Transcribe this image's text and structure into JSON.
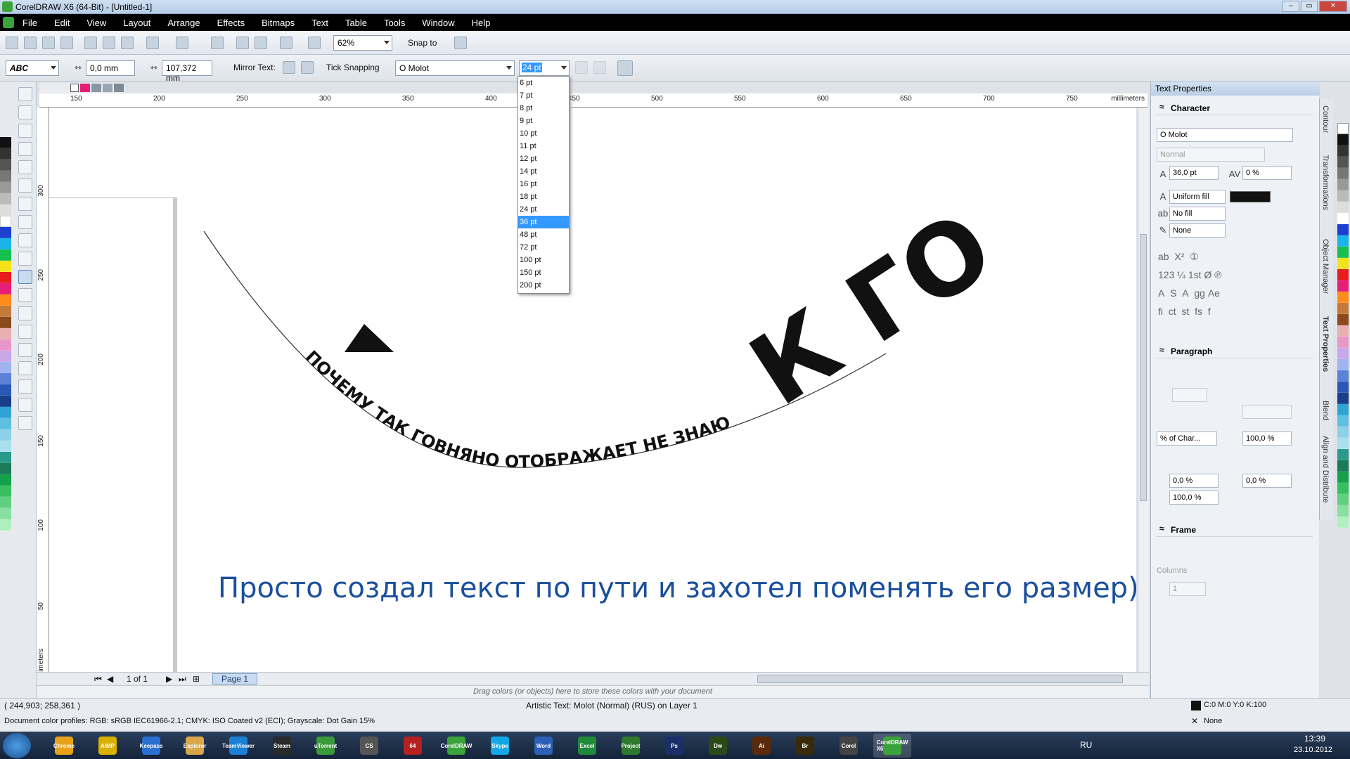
{
  "window": {
    "title": "CorelDRAW X6 (64-Bit) - [Untitled-1]"
  },
  "menu": [
    "File",
    "Edit",
    "View",
    "Layout",
    "Arrange",
    "Effects",
    "Bitmaps",
    "Text",
    "Table",
    "Tools",
    "Window",
    "Help"
  ],
  "toolbar": {
    "zoom": "62%",
    "snap_label": "Snap to"
  },
  "propbar": {
    "x_value": "0,0 mm",
    "y_value": "107,372 mm",
    "mirror_label": "Mirror Text:",
    "tick_snapping": "Tick Snapping",
    "font": "Molot",
    "size_value": "24 pt"
  },
  "size_options": [
    "6 pt",
    "7 pt",
    "8 pt",
    "9 pt",
    "10 pt",
    "11 pt",
    "12 pt",
    "14 pt",
    "16 pt",
    "18 pt",
    "24 pt",
    "36 pt",
    "48 pt",
    "72 pt",
    "100 pt",
    "150 pt",
    "200 pt"
  ],
  "size_selected_index": 11,
  "ruler": {
    "top_ticks": [
      "150",
      "200",
      "250",
      "300",
      "350",
      "400",
      "450",
      "500",
      "550",
      "600",
      "650",
      "700",
      "750"
    ],
    "units": "millimeters",
    "left_ticks": [
      "300",
      "250",
      "200",
      "150",
      "100",
      "50"
    ],
    "left_units": "millimeters"
  },
  "canvas": {
    "path_text": "ПОЧЕМУ ТАК ГОВНЯНО ОТОБРАЖАЕТ НЕ ЗНАЮ",
    "big_letters": "К ГО",
    "caption": "Просто создал текст по пути и захотел поменять его размер)"
  },
  "pager": {
    "count": "1 of 1",
    "page_tab": "Page 1"
  },
  "drag_hint": "Drag colors (or objects) here to store these colors with your document",
  "status": {
    "coords": "( 244,903; 258,361 )",
    "object_info": "Artistic Text: Molot (Normal) (RUS) on Layer 1",
    "fill_info": "C:0 M:0 Y:0 K:100",
    "outline_info": "None",
    "profiles": "Document color profiles: RGB: sRGB IEC61966-2.1; CMYK: ISO Coated v2 (ECI); Grayscale: Dot Gain 15%"
  },
  "docker": {
    "title": "Text Properties",
    "character_label": "Character",
    "font": "Molot",
    "style": "Normal",
    "size": "36,0 pt",
    "kerning": "0 %",
    "fill_type": "Uniform fill",
    "bg_fill": "No fill",
    "outline": "None",
    "paragraph_label": "Paragraph",
    "spacing_mode": "% of Char...",
    "line_spacing": "100,0 %",
    "char_spacing": "0,0 %",
    "word_spacing": "0,0 %",
    "lang_spacing": "100,0 %",
    "frame_label": "Frame",
    "columns_label": "Columns",
    "columns_value": "1"
  },
  "side_tabs": [
    "Contour",
    "Transformations",
    "Object Manager",
    "Text Properties",
    "Blend",
    "Align and Distribute"
  ],
  "taskbar": {
    "apps": [
      "Chrome",
      "AIMP",
      "Keepass",
      "Explorer",
      "TeamViewer",
      "Steam",
      "uTorrent",
      "CS",
      "64",
      "CorelDRAW",
      "Skype",
      "Word",
      "Excel",
      "Project",
      "Ps",
      "Dw",
      "Ai",
      "Br",
      "Corel",
      "CorelDRAW X6"
    ],
    "lang": "RU",
    "time": "13:39",
    "date": "23.10.2012"
  },
  "colors": {
    "accent_blue": "#1a4f9c",
    "black": "#111111",
    "selection": "#3399ff"
  }
}
